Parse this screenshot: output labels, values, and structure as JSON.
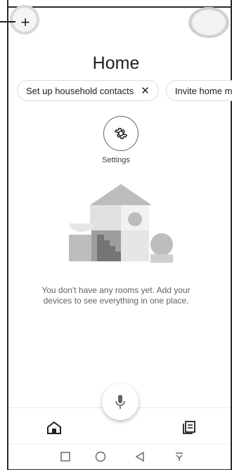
{
  "header": {
    "add_icon": "+"
  },
  "home": {
    "title": "Home"
  },
  "chips": [
    {
      "label": "Set up household contacts",
      "close": "✕"
    },
    {
      "label": "Invite home m"
    }
  ],
  "settings": {
    "label": "Settings",
    "icon": "gear-icon"
  },
  "empty_state": {
    "message": "You don't have any rooms yet. Add your devices to see everything in one place."
  },
  "bottom_nav": {
    "items": [
      "home-icon",
      "feed-icon"
    ]
  },
  "voice": {
    "icon": "mic-icon"
  },
  "system_nav": {
    "items": [
      "square",
      "circle",
      "triangle",
      "notification-shade"
    ]
  }
}
